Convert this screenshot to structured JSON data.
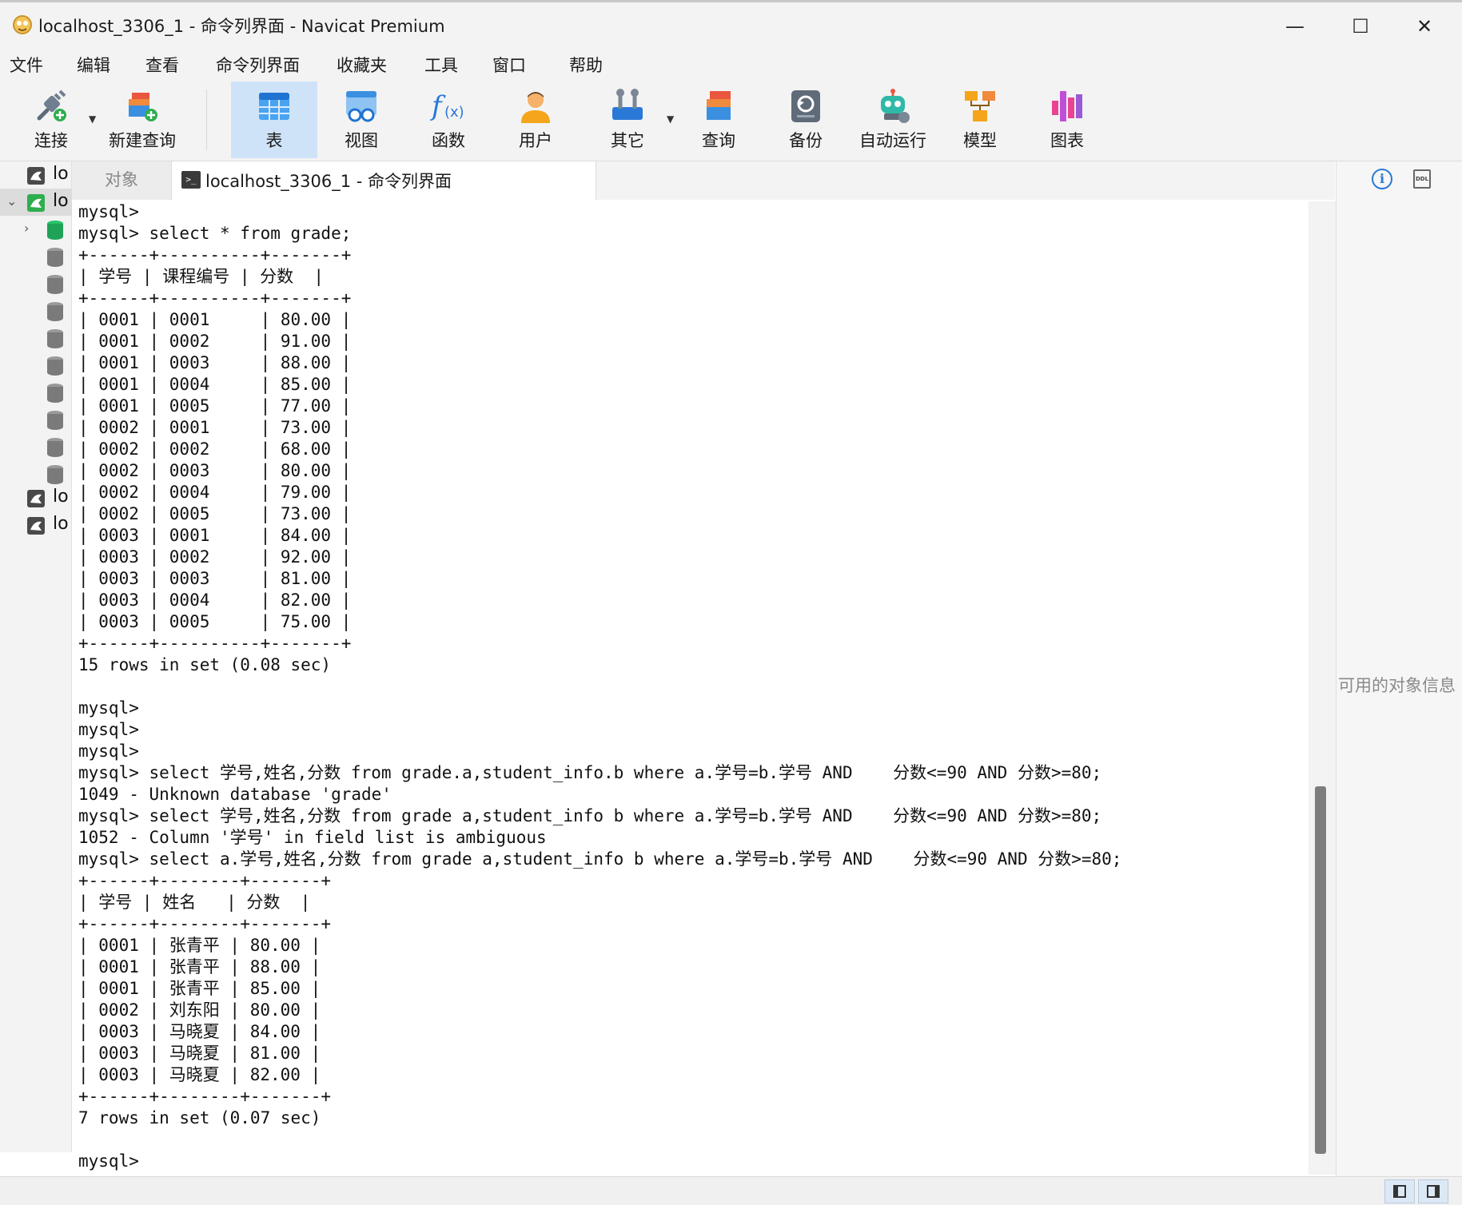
{
  "window": {
    "title": "localhost_3306_1 - 命令列界面 - Navicat Premium",
    "minimize": "—",
    "maximize": "☐",
    "close": "✕"
  },
  "menu": [
    "文件",
    "编辑",
    "查看",
    "命令列界面",
    "收藏夹",
    "工具",
    "窗口",
    "帮助"
  ],
  "toolbar": {
    "connect": "连接",
    "new_query": "新建查询",
    "table": "表",
    "view": "视图",
    "function": "函数",
    "user": "用户",
    "other": "其它",
    "query": "查询",
    "backup": "备份",
    "automation": "自动运行",
    "model": "模型",
    "chart": "图表"
  },
  "nav": {
    "items": [
      {
        "label": "lo",
        "kind": "connection"
      },
      {
        "label": "lo",
        "kind": "connection-open"
      },
      {
        "label": "",
        "kind": "database-open"
      },
      {
        "label": "",
        "kind": "database"
      },
      {
        "label": "",
        "kind": "database"
      },
      {
        "label": "",
        "kind": "database"
      },
      {
        "label": "",
        "kind": "database"
      },
      {
        "label": "",
        "kind": "database"
      },
      {
        "label": "",
        "kind": "database"
      },
      {
        "label": "",
        "kind": "database"
      },
      {
        "label": "",
        "kind": "database"
      },
      {
        "label": "lo",
        "kind": "connection"
      },
      {
        "label": "lo",
        "kind": "connection"
      }
    ]
  },
  "tabs": {
    "objects": "对象",
    "console_icon": ">_",
    "console": "localhost_3306_1 - 命令列界面"
  },
  "console": {
    "lines": [
      "mysql>",
      "mysql> select * from grade;",
      "+------+----------+-------+",
      "| 学号 | 课程编号 | 分数  |",
      "+------+----------+-------+",
      "| 0001 | 0001     | 80.00 |",
      "| 0001 | 0002     | 91.00 |",
      "| 0001 | 0003     | 88.00 |",
      "| 0001 | 0004     | 85.00 |",
      "| 0001 | 0005     | 77.00 |",
      "| 0002 | 0001     | 73.00 |",
      "| 0002 | 0002     | 68.00 |",
      "| 0002 | 0003     | 80.00 |",
      "| 0002 | 0004     | 79.00 |",
      "| 0002 | 0005     | 73.00 |",
      "| 0003 | 0001     | 84.00 |",
      "| 0003 | 0002     | 92.00 |",
      "| 0003 | 0003     | 81.00 |",
      "| 0003 | 0004     | 82.00 |",
      "| 0003 | 0005     | 75.00 |",
      "+------+----------+-------+",
      "15 rows in set (0.08 sec)",
      "",
      "mysql>",
      "mysql>",
      "mysql>",
      "mysql> select 学号,姓名,分数 from grade.a,student_info.b where a.学号=b.学号 AND    分数<=90 AND 分数>=80;",
      "1049 - Unknown database 'grade'",
      "mysql> select 学号,姓名,分数 from grade a,student_info b where a.学号=b.学号 AND    分数<=90 AND 分数>=80;",
      "1052 - Column '学号' in field list is ambiguous",
      "mysql> select a.学号,姓名,分数 from grade a,student_info b where a.学号=b.学号 AND    分数<=90 AND 分数>=80;",
      "+------+--------+-------+",
      "| 学号 | 姓名   | 分数  |",
      "+------+--------+-------+",
      "| 0001 | 张青平 | 80.00 |",
      "| 0001 | 张青平 | 88.00 |",
      "| 0001 | 张青平 | 85.00 |",
      "| 0002 | 刘东阳 | 80.00 |",
      "| 0003 | 马晓夏 | 84.00 |",
      "| 0003 | 马晓夏 | 81.00 |",
      "| 0003 | 马晓夏 | 82.00 |",
      "+------+--------+-------+",
      "7 rows in set (0.07 sec)",
      "",
      "mysql>"
    ]
  },
  "info_pane": {
    "message": "可用的对象信息"
  },
  "colors": {
    "accent": "#2a79d8",
    "active_tool": "#cfe3f8",
    "chrome": "#f3f3f3"
  }
}
